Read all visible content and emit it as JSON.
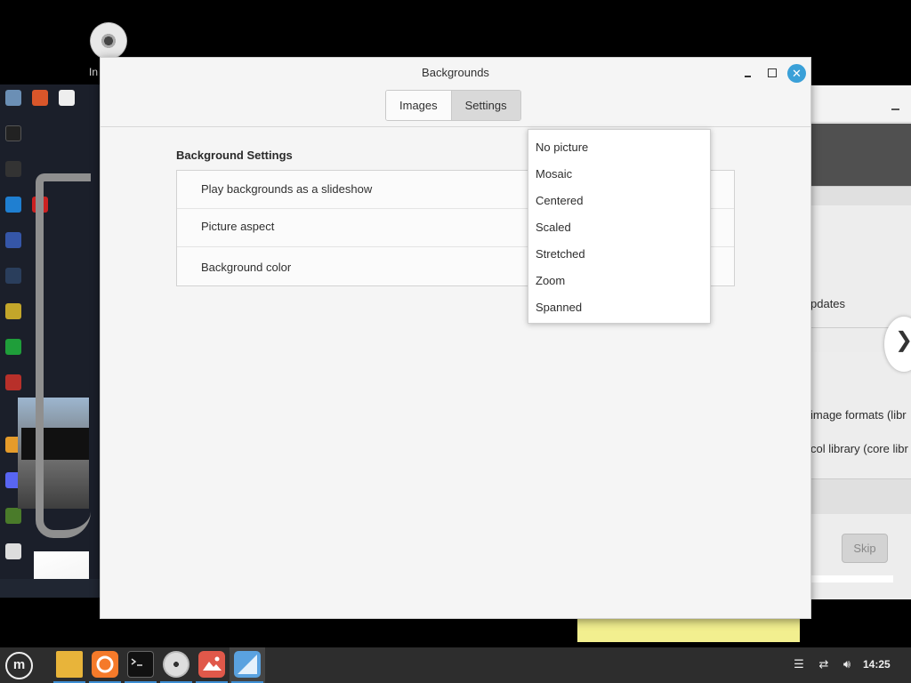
{
  "dialog": {
    "title": "Backgrounds",
    "tabs": [
      {
        "label": "Images"
      },
      {
        "label": "Settings"
      }
    ],
    "section_title": "Background Settings",
    "rows": [
      {
        "label": "Play backgrounds as a slideshow"
      },
      {
        "label": "Picture aspect"
      },
      {
        "label": "Background color"
      }
    ],
    "close_glyph": "✕"
  },
  "dropdown": {
    "options": [
      "No picture",
      "Mosaic",
      "Centered",
      "Scaled",
      "Stretched",
      "Zoom",
      "Spanned"
    ]
  },
  "desktop": {
    "icon_label": "In"
  },
  "right_window": {
    "texts": [
      "pdates",
      "image formats (libr",
      "col library (core libr"
    ],
    "skip_label": "Skip",
    "next_glyph": "❯"
  },
  "taskbar": {
    "menu_glyph": "m",
    "apps": [
      "files-icon",
      "firefox-icon",
      "terminal-icon",
      "disc-icon",
      "image-viewer-icon",
      "backgrounds-icon"
    ],
    "clock": "14:25"
  },
  "colors": {
    "accent": "#3aa0d8",
    "taskbar": "#2d2d2d",
    "dialog_bg": "#f5f5f5"
  }
}
